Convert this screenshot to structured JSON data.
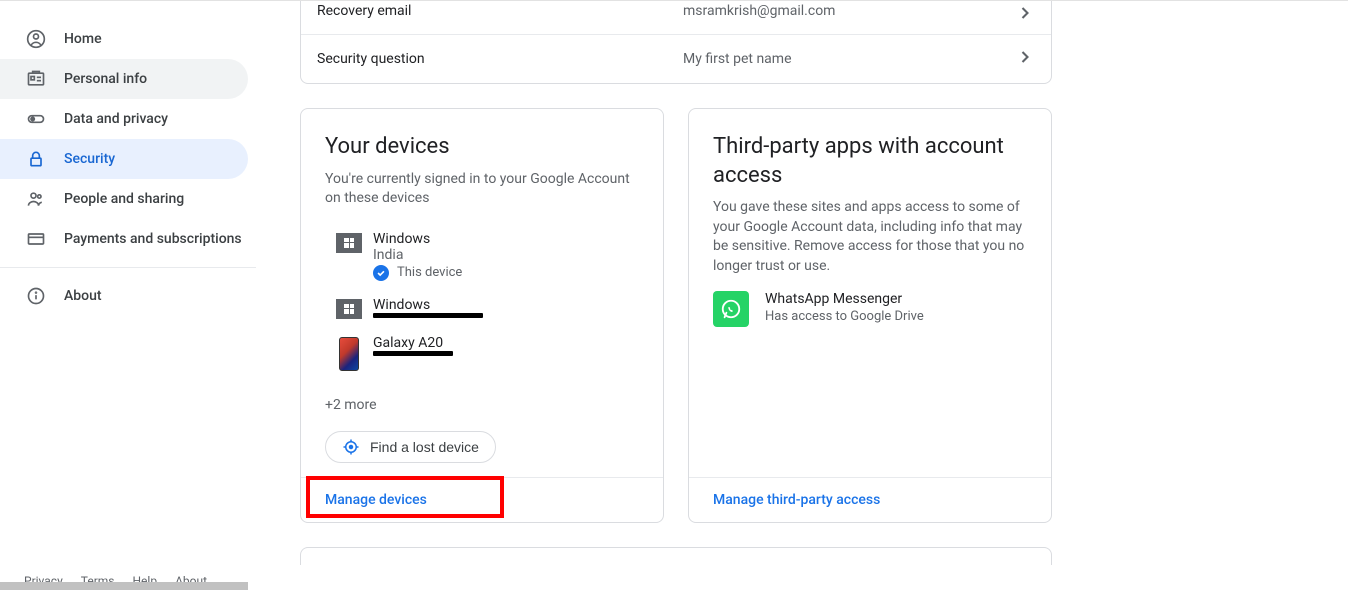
{
  "sidebar": {
    "items": [
      {
        "label": "Home"
      },
      {
        "label": "Personal info"
      },
      {
        "label": "Data and privacy"
      },
      {
        "label": "Security"
      },
      {
        "label": "People and sharing"
      },
      {
        "label": "Payments and subscriptions"
      },
      {
        "label": "About"
      }
    ]
  },
  "recovery": {
    "rows": [
      {
        "label": "Recovery email",
        "value": "msramkrish@gmail.com"
      },
      {
        "label": "Security question",
        "value": "My first pet name"
      }
    ]
  },
  "devices_card": {
    "title": "Your devices",
    "subtitle": "You're currently signed in to your Google Account on these devices",
    "devices": [
      {
        "name": "Windows",
        "location": "India",
        "this_device_label": "This device"
      },
      {
        "name": "Windows"
      },
      {
        "name": "Galaxy A20"
      }
    ],
    "more_label": "+2 more",
    "find_label": "Find a lost device",
    "manage_label": "Manage devices"
  },
  "thirdparty_card": {
    "title": "Third-party apps with account access",
    "subtitle": "You gave these sites and apps access to some of your Google Account data, including info that may be sensitive. Remove access for those that you no longer trust or use.",
    "apps": [
      {
        "name": "WhatsApp Messenger",
        "access": "Has access to Google Drive"
      }
    ],
    "manage_label": "Manage third-party access"
  },
  "footer": {
    "privacy": "Privacy",
    "terms": "Terms",
    "help": "Help",
    "about": "About"
  }
}
